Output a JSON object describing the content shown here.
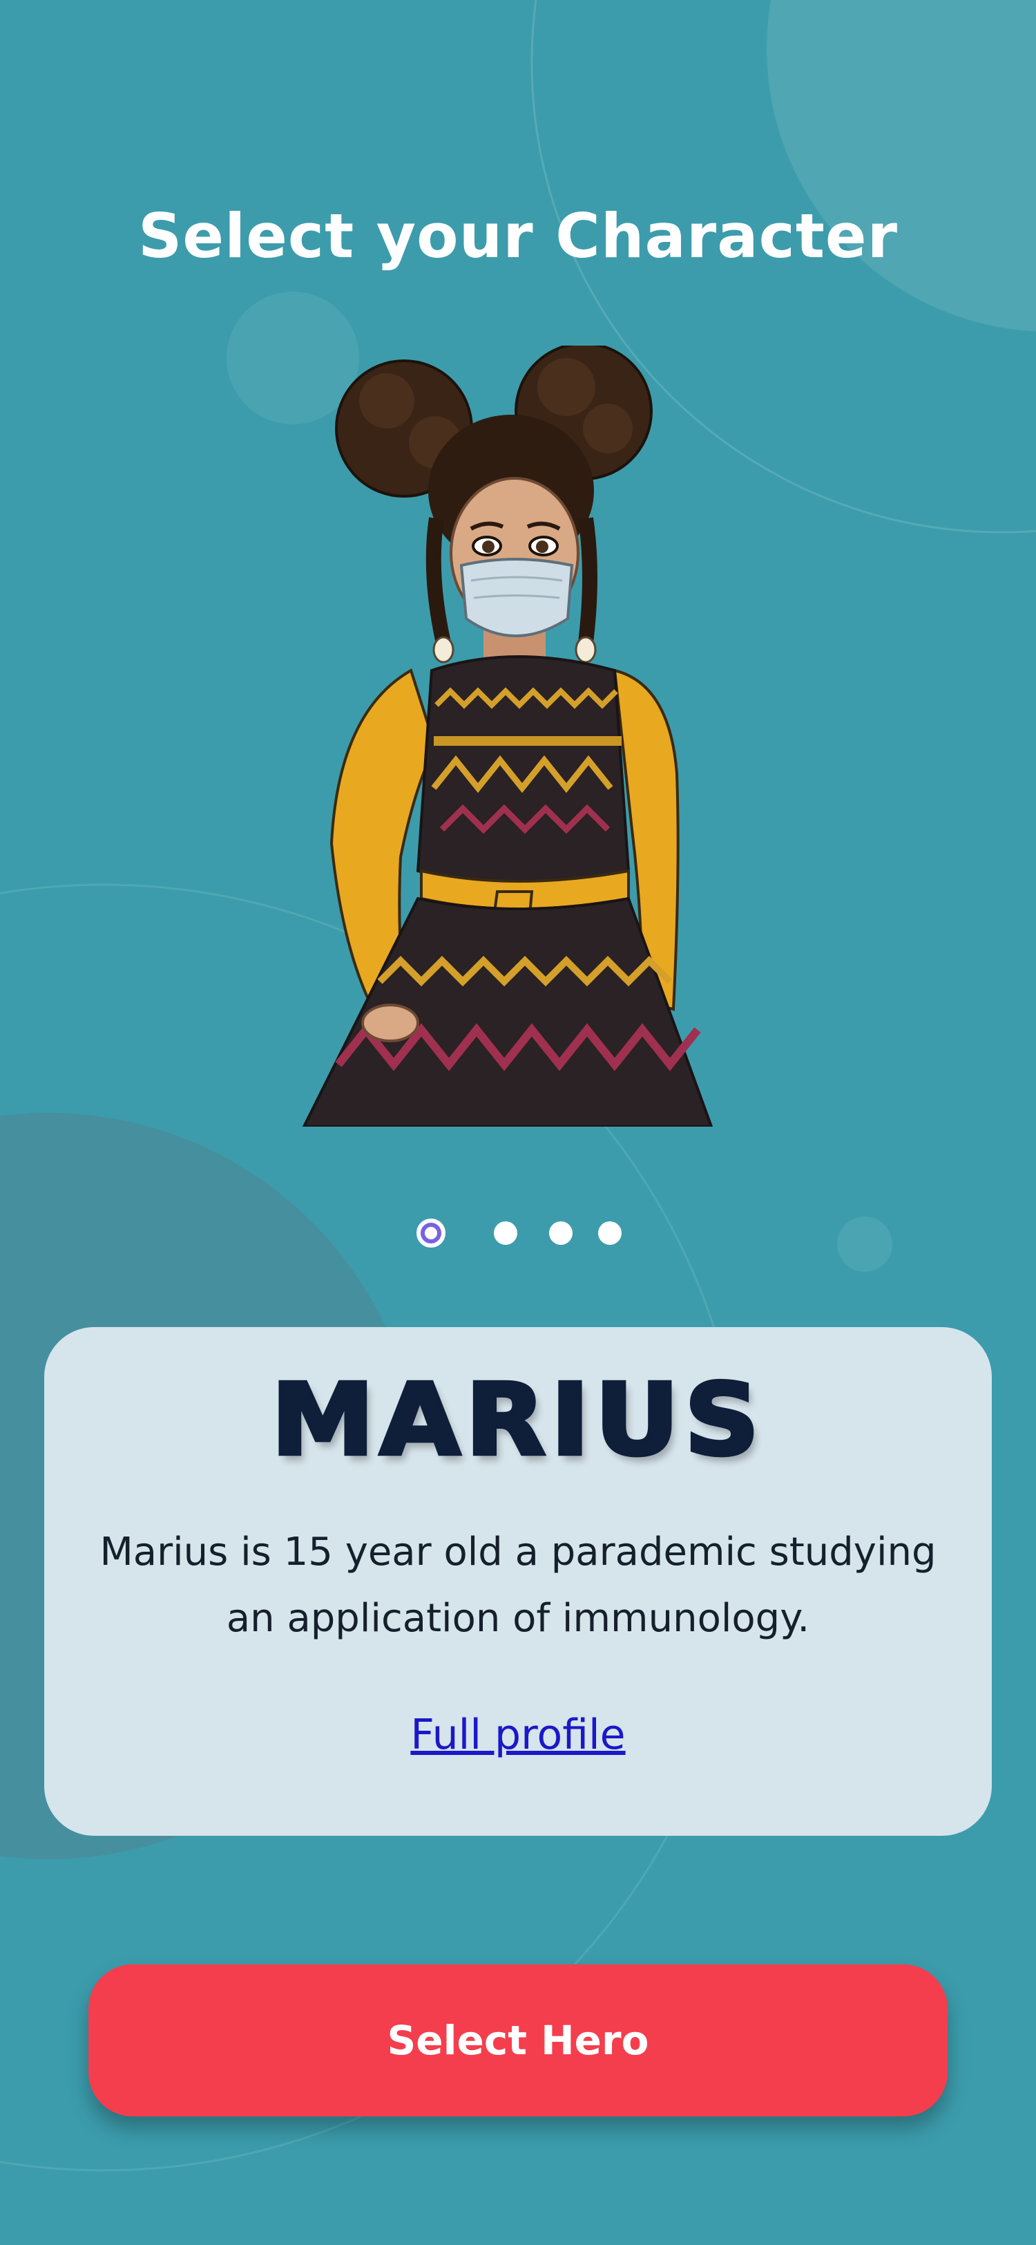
{
  "header": {
    "title": "Select your Character"
  },
  "carousel": {
    "page_count": 4,
    "active_index": 0
  },
  "character": {
    "name": "MARIUS",
    "description": "Marius is 15 year old a parademic studying an application of immunology.",
    "profile_link": "Full profile"
  },
  "actions": {
    "select_label": "Select Hero"
  },
  "colors": {
    "background": "#3c9cac",
    "card": "#d6e4eb",
    "cta": "#f43e4d",
    "active_dot": "#7763e0",
    "name_text": "#0f1f3a",
    "link": "#1a18c8"
  }
}
